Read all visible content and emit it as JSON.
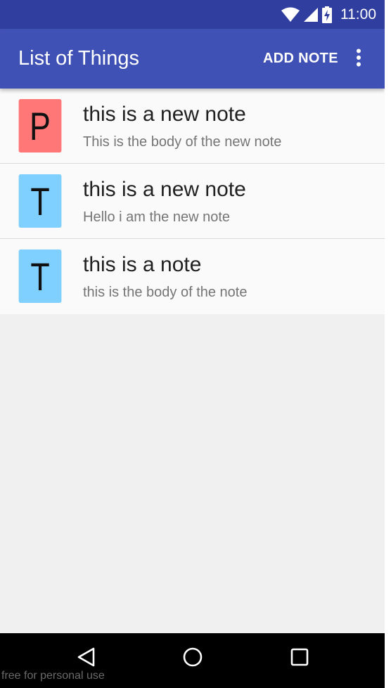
{
  "status_bar": {
    "time": "11:00",
    "icons": [
      "wifi-icon",
      "cell-signal-icon",
      "battery-charging-icon"
    ]
  },
  "app_bar": {
    "title": "List of Things",
    "action_label": "ADD NOTE",
    "overflow_icon": "more-vert-icon"
  },
  "notes": [
    {
      "letter": "P",
      "title": "this is a new note",
      "body": "This is the body of the new note",
      "color": "#ff7777"
    },
    {
      "letter": "T",
      "title": "this is a new note",
      "body": "Hello i am the new note",
      "color": "#7fcfff"
    },
    {
      "letter": "T",
      "title": "this is a note",
      "body": "this is the body of the note",
      "color": "#7fcfff"
    }
  ],
  "nav_bar": {
    "icons": [
      "back-icon",
      "home-icon",
      "recents-icon"
    ]
  },
  "watermark": "free for personal use",
  "colors": {
    "status_bar": "#303f9f",
    "app_bar": "#3f51b5",
    "list_background": "#fafafa",
    "screen_background": "#f0f0f0"
  }
}
